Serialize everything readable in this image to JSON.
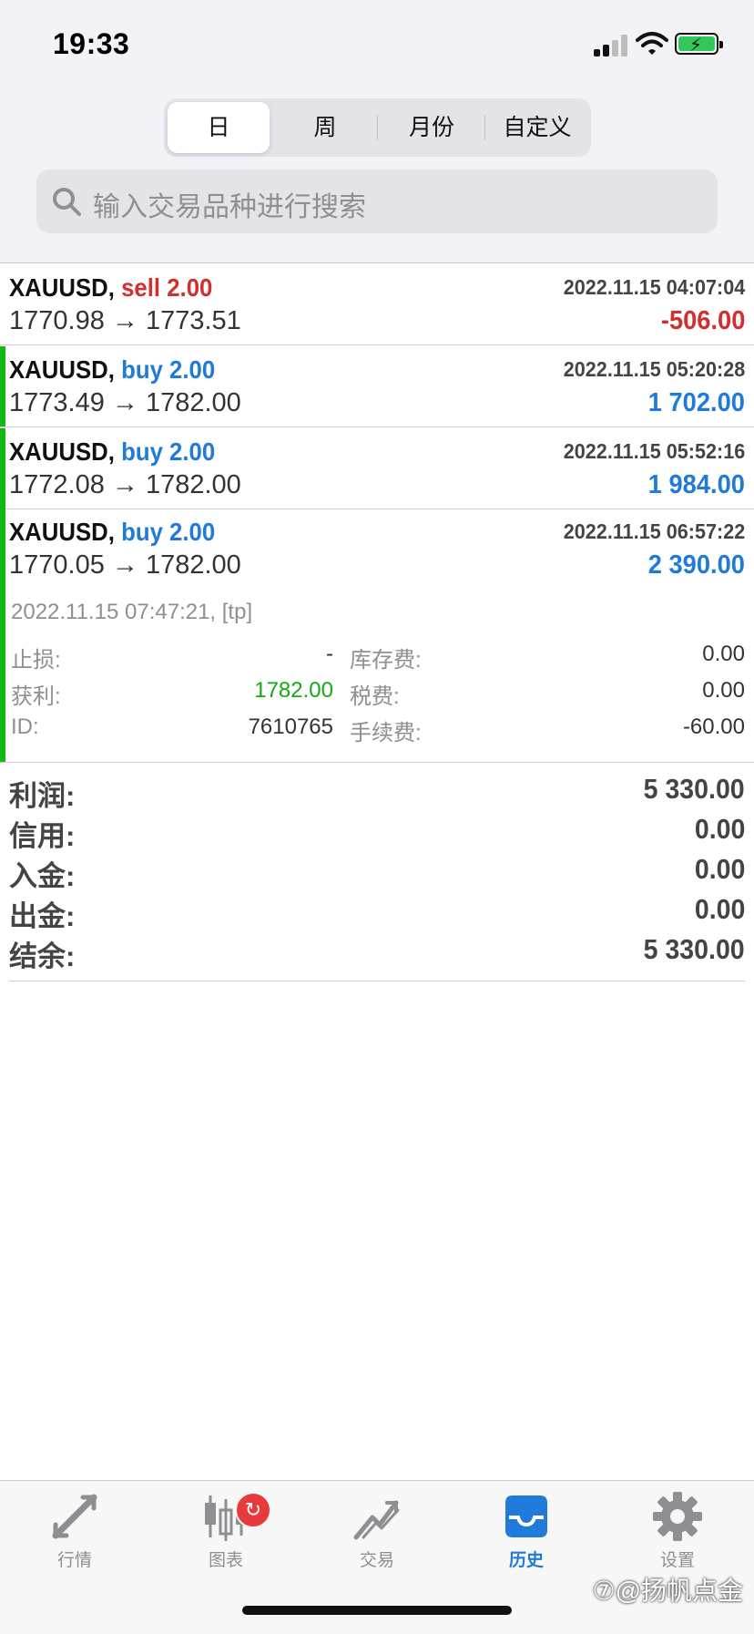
{
  "status_bar": {
    "time": "19:33"
  },
  "segments": [
    {
      "label": "日",
      "active": true
    },
    {
      "label": "周"
    },
    {
      "label": "月份"
    },
    {
      "label": "自定义"
    }
  ],
  "search": {
    "placeholder": "输入交易品种进行搜索"
  },
  "trades": [
    {
      "symbol": "XAUUSD,",
      "side": "sell 2.00",
      "datetime": "2022.11.15 04:07:04",
      "prices": "1770.98 → 1773.51",
      "profit": "-506.00"
    },
    {
      "symbol": "XAUUSD,",
      "side": "buy 2.00",
      "datetime": "2022.11.15 05:20:28",
      "prices": "1773.49 → 1782.00",
      "profit": "1 702.00"
    },
    {
      "symbol": "XAUUSD,",
      "side": "buy 2.00",
      "datetime": "2022.11.15 05:52:16",
      "prices": "1772.08 → 1782.00",
      "profit": "1 984.00"
    },
    {
      "symbol": "XAUUSD,",
      "side": "buy 2.00",
      "datetime": "2022.11.15 06:57:22",
      "prices": "1770.05 → 1782.00",
      "profit": "2 390.00"
    }
  ],
  "details": {
    "close_info": "2022.11.15 07:47:21, [tp]",
    "stop_loss_label": "止损:",
    "stop_loss_value": "-",
    "take_profit_label": "获利:",
    "take_profit_value": "1782.00",
    "id_label": "ID:",
    "id_value": "7610765",
    "swap_label": "库存费:",
    "swap_value": "0.00",
    "tax_label": "税费:",
    "tax_value": "0.00",
    "commission_label": "手续费:",
    "commission_value": "-60.00"
  },
  "summary": [
    {
      "label": "利润:",
      "value": "5 330.00"
    },
    {
      "label": "信用:",
      "value": "0.00"
    },
    {
      "label": "入金:",
      "value": "0.00"
    },
    {
      "label": "出金:",
      "value": "0.00"
    },
    {
      "label": "结余:",
      "value": "5 330.00"
    }
  ],
  "tabbar": {
    "items": [
      {
        "label": "行情",
        "icon": "quotes-arrows-icon"
      },
      {
        "label": "图表",
        "icon": "candlestick-chart-icon",
        "badge": "↻"
      },
      {
        "label": "交易",
        "icon": "trade-chart-icon"
      },
      {
        "label": "历史",
        "icon": "history-inbox-icon",
        "active": true
      },
      {
        "label": "设置",
        "icon": "gear-icon"
      }
    ]
  },
  "watermark": "⑦@扬帆点金",
  "colors": {
    "sell": "#d32f2f",
    "buy": "#1f7ad9",
    "accent_green": "#14b814",
    "active_tab": "#1f7ad9"
  }
}
